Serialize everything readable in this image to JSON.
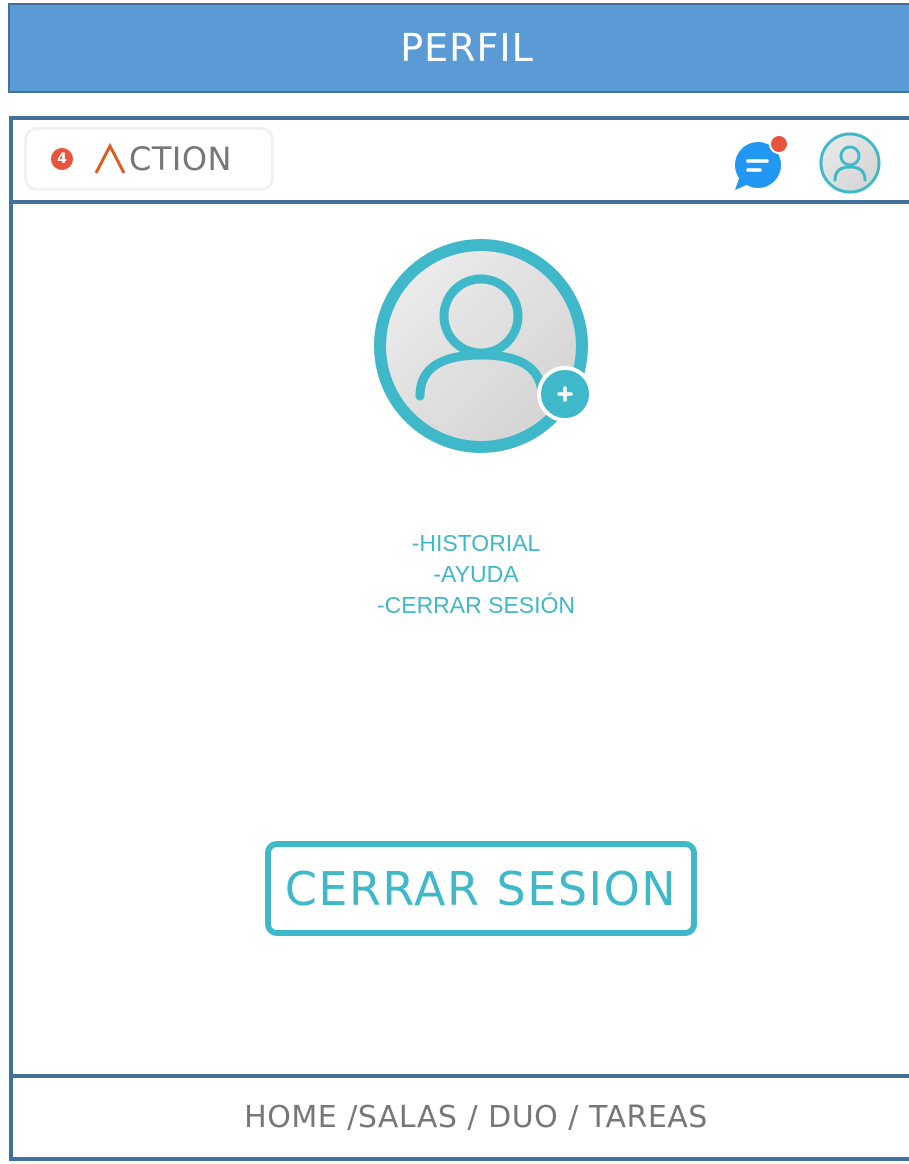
{
  "header": {
    "title": "PERFIL"
  },
  "app_bar": {
    "logo_badge": "4",
    "logo_text": "CTION",
    "chat_icon": "chat-notification-icon",
    "avatar_icon": "user-avatar-icon"
  },
  "profile": {
    "avatar_icon": "user-avatar-icon",
    "add_photo_icon": "plus-icon"
  },
  "menu": {
    "items": [
      {
        "label": "-HISTORIAL"
      },
      {
        "label": "-AYUDA"
      },
      {
        "label": "-CERRAR SESIÓN"
      }
    ]
  },
  "logout_button": {
    "label": "CERRAR SESION"
  },
  "bottom_nav": {
    "items": [
      {
        "label": "HOME"
      },
      {
        "label": "SALAS"
      },
      {
        "label": "DUO"
      },
      {
        "label": "TAREAS"
      }
    ]
  },
  "colors": {
    "title_bar": "#5b9bd5",
    "frame_border": "#41719c",
    "accent_teal": "#3fb8c9",
    "chat_blue": "#2196f3",
    "notification_dot": "#e8543e",
    "logo_caret": "#e05a1c"
  }
}
